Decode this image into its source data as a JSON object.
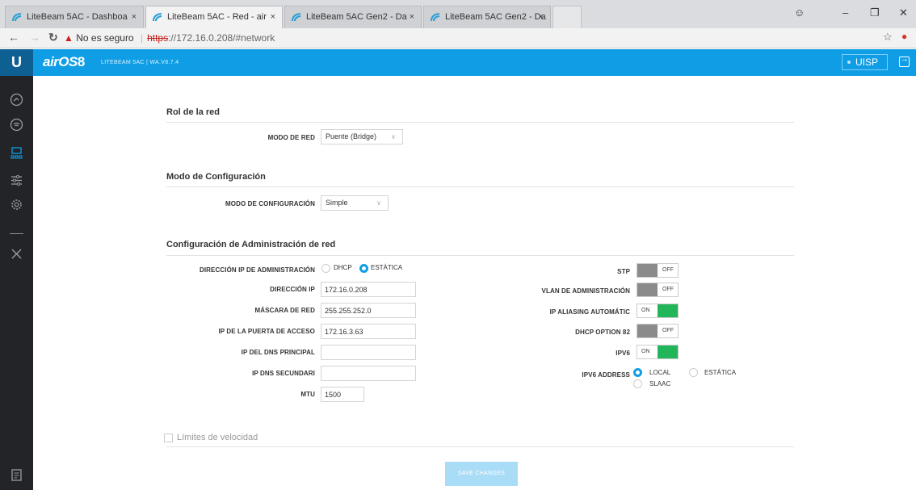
{
  "browser": {
    "tabs": [
      {
        "title": "LiteBeam 5AC - Dashboa",
        "active": false
      },
      {
        "title": "LiteBeam 5AC - Red - air",
        "active": true
      },
      {
        "title": "LiteBeam 5AC Gen2 - Da",
        "active": false
      },
      {
        "title": "LiteBeam 5AC Gen2 - Da",
        "active": false
      }
    ],
    "close_glyph": "×",
    "security_label": "No es seguro",
    "url_scheme": "https",
    "url_rest": "://172.16.0.208/#network"
  },
  "app": {
    "brand": "airOS",
    "version": "8",
    "subtitle": "LITEBEAM 5AC | WA.V8.7.4",
    "uisp_label": "UISP",
    "accent_color": "#0f9ee5"
  },
  "sidebar": {
    "icons": [
      "dashboard-icon",
      "wireless-icon",
      "network-icon",
      "services-icon",
      "system-icon",
      "tools-icon",
      "log-icon"
    ],
    "active": "network-icon"
  },
  "sections": {
    "network_role": {
      "title": "Rol de la red",
      "mode_label": "MODO DE RED",
      "mode_value": "Puente (Bridge)"
    },
    "config_mode": {
      "title": "Modo de Configuración",
      "label": "MODO DE CONFIGURACIÓN",
      "value": "Simple"
    },
    "mgmt": {
      "title": "Configuración de Administración de red",
      "ip_mode_label": "DIRECCIÓN IP DE ADMINISTRACIÓN",
      "ip_mode_options": [
        "DHCP",
        "ESTÁTICA"
      ],
      "ip_mode_selected": "ESTÁTICA",
      "ip_label": "DIRECCIÓN IP",
      "ip_value": "172.16.0.208",
      "mask_label": "MÁSCARA DE RED",
      "mask_value": "255.255.252.0",
      "gateway_label": "IP DE LA PUERTA DE ACCESO",
      "gateway_value": "172.16.3.63",
      "dns1_label": "IP DEL DNS PRINCIPAL",
      "dns1_value": "",
      "dns2_label": "IP DNS SECUNDARI",
      "dns2_value": "",
      "mtu_label": "MTU",
      "mtu_value": "1500",
      "stp_label": "STP",
      "stp_state": "OFF",
      "vlan_label": "VLAN DE ADMINISTRACIÓN",
      "vlan_state": "OFF",
      "alias_label": "IP ALIASING AUTOMÁTIC",
      "alias_state": "ON",
      "dhcp82_label": "DHCP OPTION 82",
      "dhcp82_state": "OFF",
      "ipv6_label": "IPV6",
      "ipv6_state": "ON",
      "ipv6_addr_label": "IPV6 ADDRESS",
      "ipv6_opt_local": "LOCAL",
      "ipv6_opt_static": "ESTÁTICA",
      "ipv6_opt_slaac": "SLAAC",
      "ipv6_selected": "LOCAL"
    },
    "speed": {
      "label": "Límites de velocidad",
      "checked": false
    }
  },
  "save_label": "SAVE CHANGES"
}
